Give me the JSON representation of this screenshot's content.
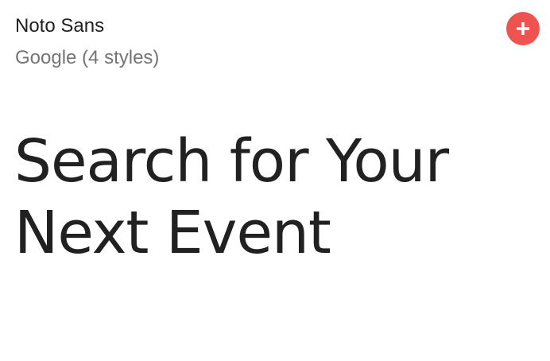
{
  "font_card": {
    "name": "Noto Sans",
    "meta": "Google (4 styles)",
    "add_icon": "plus-icon",
    "sample_text": "Search for Your Next Event"
  },
  "colors": {
    "accent": "#ef5350",
    "title_text": "#212121",
    "meta_text": "#757575",
    "background": "#ffffff"
  }
}
